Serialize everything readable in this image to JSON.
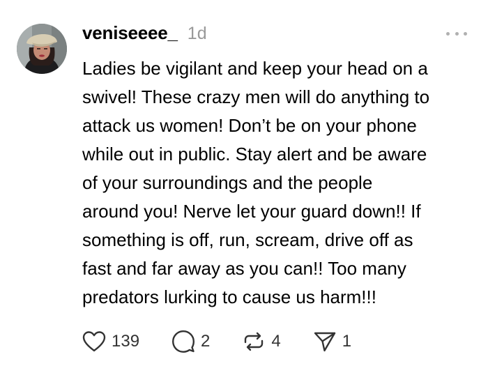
{
  "post": {
    "username": "veniseeee_",
    "timestamp": "1d",
    "text": "Ladies be vigilant and keep your head on a\nswivel! These crazy men will do anything to\nattack us women! Don’t be on your phone\nwhile out in public. Stay alert and be aware\nof your surroundings and the people\naround you! Nerve let your guard down!! If\nsomething is off, run, scream, drive off as\nfast and far away as you can!! Too many\npredators lurking to cause us harm!!!",
    "more_icon": "more-horizontal-icon"
  },
  "actions": {
    "like": {
      "icon": "heart-icon",
      "count": "139"
    },
    "reply": {
      "icon": "comment-icon",
      "count": "2"
    },
    "repost": {
      "icon": "repost-icon",
      "count": "4"
    },
    "share": {
      "icon": "send-icon",
      "count": "1"
    }
  },
  "colors": {
    "text": "#000000",
    "muted": "#999999",
    "icon": "#333333",
    "background": "#ffffff"
  }
}
